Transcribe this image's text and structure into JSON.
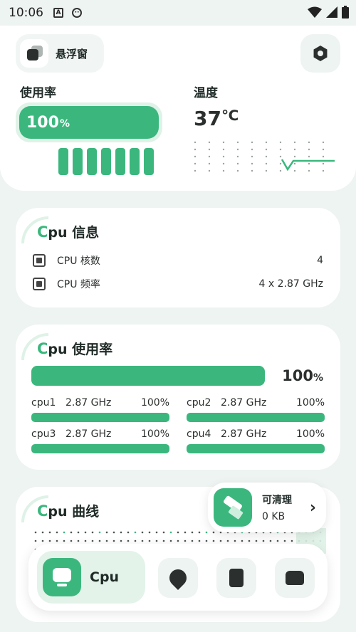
{
  "status_bar": {
    "time": "10:06",
    "icons": [
      "a-icon",
      "notification-icon"
    ],
    "right_icons": [
      "wifi-icon",
      "signal-icon",
      "battery-icon"
    ]
  },
  "top": {
    "float_window_label": "悬浮窗",
    "usage_title": "使用率",
    "usage_value": "100",
    "usage_unit": "%",
    "usage_level": 1.0,
    "core_count_bars": 7,
    "temp_title": "温度",
    "temp_value": "37",
    "temp_unit": "℃"
  },
  "cpu_info": {
    "title_accent": "C",
    "title_rest": "pu 信息",
    "rows": [
      {
        "label": "CPU 核数",
        "value": "4"
      },
      {
        "label": "CPU 频率",
        "value": "4 x 2.87 GHz"
      }
    ]
  },
  "cpu_usage": {
    "title_accent": "C",
    "title_rest": "pu 使用率",
    "total_value": "100",
    "total_unit": "%",
    "total_level": 1.0,
    "cores": [
      {
        "name": "cpu1",
        "freq": "2.87 GHz",
        "value": "100%",
        "level": 1.0
      },
      {
        "name": "cpu2",
        "freq": "2.87 GHz",
        "value": "100%",
        "level": 1.0
      },
      {
        "name": "cpu3",
        "freq": "2.87 GHz",
        "value": "100%",
        "level": 1.0
      },
      {
        "name": "cpu4",
        "freq": "2.87 GHz",
        "value": "100%",
        "level": 1.0
      }
    ]
  },
  "cpu_curve": {
    "title_accent": "C",
    "title_rest": "pu 曲线"
  },
  "clean": {
    "title": "可清理",
    "size": "0 KB"
  },
  "nav": {
    "cpu_label": "Cpu",
    "items": [
      "location-icon",
      "sd-card-icon",
      "android-icon"
    ]
  },
  "colors": {
    "accent": "#3bb77e",
    "accent_light": "#dff2e7",
    "background": "#eef4f1"
  }
}
